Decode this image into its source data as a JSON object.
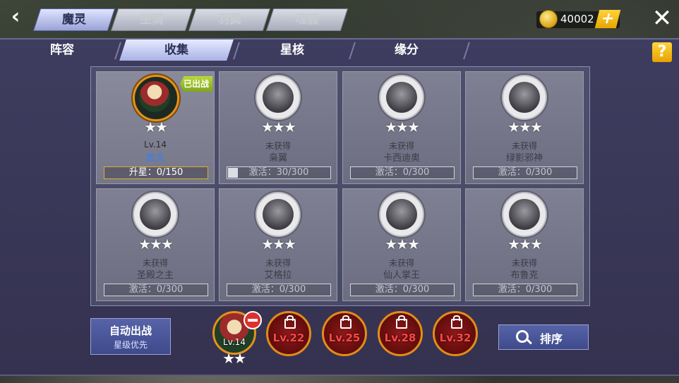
{
  "top_tabs": [
    "魔灵",
    "坐骑",
    "羽翼",
    "魂器"
  ],
  "currency": {
    "amount": "40002",
    "icon": "gold-coin-icon",
    "plus": "+"
  },
  "icons": {
    "back": "‹",
    "close": "✕",
    "help": "?"
  },
  "sub_tabs": [
    "阵容",
    "收集",
    "星核",
    "缘分"
  ],
  "cards": [
    {
      "name": "凯文",
      "owned": true,
      "level": "Lv.14",
      "tag": "已出战",
      "stars": "★★",
      "progress_text": "升星：0/150",
      "progress": 0
    },
    {
      "name": "枭翼",
      "owned": false,
      "status": "未获得",
      "stars": "★★★",
      "progress_text": "激活：30/300",
      "progress": 0.1
    },
    {
      "name": "卡西迪奥",
      "owned": false,
      "status": "未获得",
      "stars": "★★★",
      "progress_text": "激活：0/300",
      "progress": 0
    },
    {
      "name": "绿影邪神",
      "owned": false,
      "status": "未获得",
      "stars": "★★★",
      "progress_text": "激活：0/300",
      "progress": 0
    },
    {
      "name": "圣殿之主",
      "owned": false,
      "status": "未获得",
      "stars": "★★★",
      "progress_text": "激活：0/300",
      "progress": 0
    },
    {
      "name": "艾格拉",
      "owned": false,
      "status": "未获得",
      "stars": "★★★",
      "progress_text": "激活：0/300",
      "progress": 0
    },
    {
      "name": "仙人掌王",
      "owned": false,
      "status": "未获得",
      "stars": "★★★",
      "progress_text": "激活：0/300",
      "progress": 0
    },
    {
      "name": "布鲁克",
      "owned": false,
      "status": "未获得",
      "stars": "★★★",
      "progress_text": "激活：0/300",
      "progress": 0
    }
  ],
  "auto_button": {
    "title": "自动出战",
    "subtitle": "星级优先"
  },
  "team": {
    "level": "Lv.14",
    "stars": "★★"
  },
  "locked_slots": [
    "Lv.22",
    "Lv.25",
    "Lv.28",
    "Lv.32"
  ],
  "sort_button": {
    "label": "排序"
  }
}
